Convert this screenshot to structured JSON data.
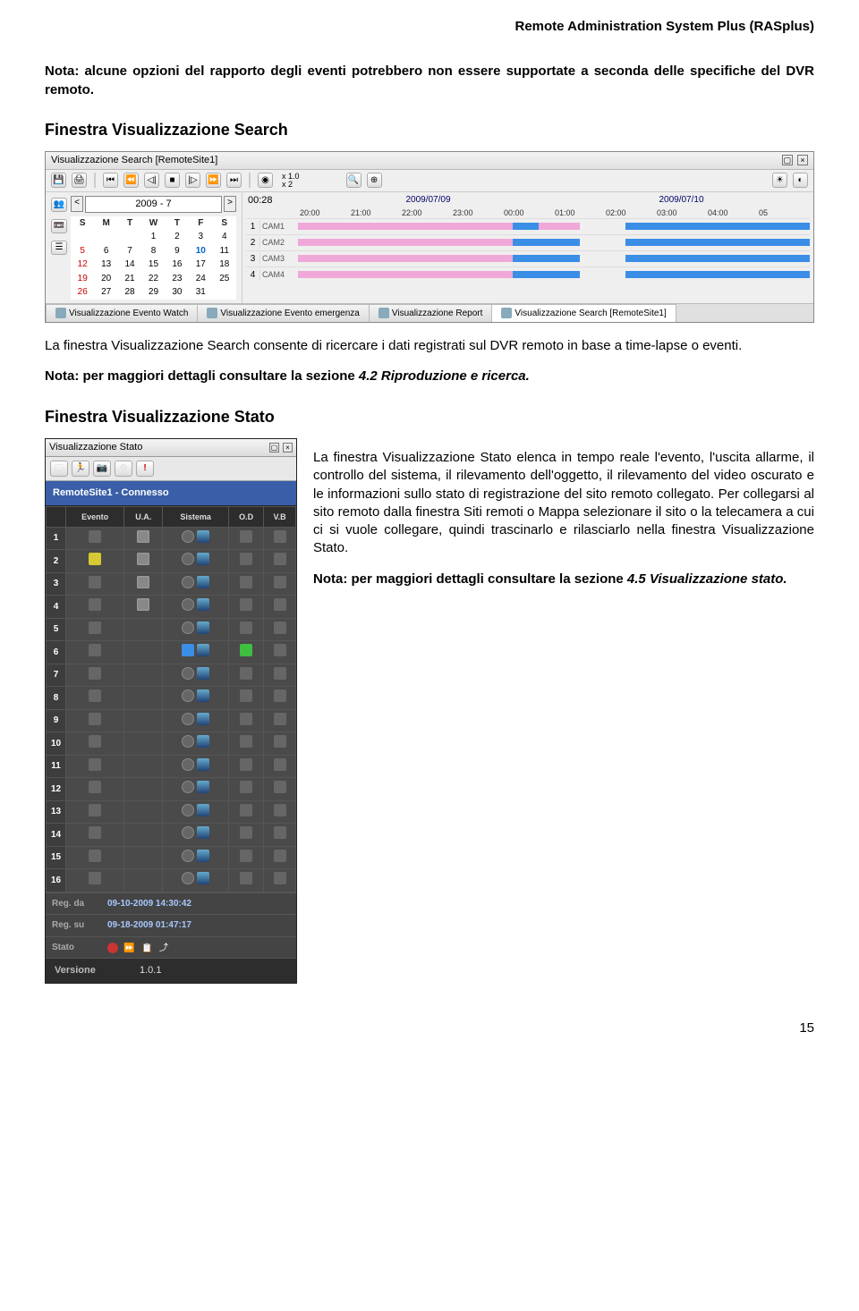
{
  "doc_header": "Remote Administration System Plus (RASplus)",
  "note_support": "Nota: alcune opzioni del rapporto degli eventi potrebbero non essere supportate a seconda delle specifiche del DVR remoto.",
  "heading_search": "Finestra Visualizzazione Search",
  "search_panel": {
    "title": "Visualizzazione Search [RemoteSite1]",
    "speed1": "x 1.0",
    "speed2": "x 2",
    "date_field": "2009 - 7",
    "cal_dow": [
      "S",
      "M",
      "T",
      "W",
      "T",
      "F",
      "S"
    ],
    "cal_rows": [
      [
        "",
        "",
        "",
        "1",
        "2",
        "3",
        "4"
      ],
      [
        "5",
        "6",
        "7",
        "8",
        "9",
        "10",
        "11"
      ],
      [
        "12",
        "13",
        "14",
        "15",
        "16",
        "17",
        "18"
      ],
      [
        "19",
        "20",
        "21",
        "22",
        "23",
        "24",
        "25"
      ],
      [
        "26",
        "27",
        "28",
        "29",
        "30",
        "31",
        ""
      ]
    ],
    "red_time": "00:28",
    "date_left": "2009/07/09",
    "date_right": "2009/07/10",
    "hours": [
      "20:00",
      "21:00",
      "22:00",
      "23:00",
      "00:00",
      "01:00",
      "02:00",
      "03:00",
      "04:00",
      "05"
    ],
    "cams": [
      {
        "n": "1",
        "label": "CAM1"
      },
      {
        "n": "2",
        "label": "CAM2"
      },
      {
        "n": "3",
        "label": "CAM3"
      },
      {
        "n": "4",
        "label": "CAM4"
      }
    ],
    "tabs": {
      "t1": "Visualizzazione Evento Watch",
      "t2": "Visualizzazione Evento emergenza",
      "t3": "Visualizzazione Report",
      "t4": "Visualizzazione Search [RemoteSite1]"
    }
  },
  "search_desc_1": "La finestra ",
  "search_desc_term": "Visualizzazione Search",
  "search_desc_2": " consente di ricercare i dati registrati sul DVR remoto in base a time-lapse o eventi.",
  "note_ref_search": "Nota: per maggiori dettagli consultare la sezione ",
  "note_ref_search_em": "4.2 Riproduzione e ricerca.",
  "heading_stato": "Finestra Visualizzazione Stato",
  "stato_panel": {
    "title": "Visualizzazione Stato",
    "conn": "RemoteSite1 - Connesso",
    "cols": {
      "c1": "Evento",
      "c2": "U.A.",
      "c3": "Sistema",
      "c4": "O.D",
      "c5": "V.B"
    },
    "rows": [
      "1",
      "2",
      "3",
      "4",
      "5",
      "6",
      "7",
      "8",
      "9",
      "10",
      "11",
      "12",
      "13",
      "14",
      "15",
      "16"
    ],
    "reg_da_label": "Reg. da",
    "reg_da_val": "09-10-2009 14:30:42",
    "reg_su_label": "Reg. su",
    "reg_su_val": "09-18-2009 01:47:17",
    "stato_label": "Stato",
    "versione_label": "Versione",
    "versione_val": "1.0.1"
  },
  "stato_desc": "La finestra Visualizzazione Stato elenca in tempo reale l'evento, l'uscita allarme, il controllo del sistema, il rilevamento dell'oggetto, il rilevamento del video oscurato e le informazioni sullo stato di registrazione del sito remoto collegato. Per collegarsi al sito remoto dalla finestra Siti remoti o Mappa selezionare il sito o la telecamera a cui ci si vuole collegare, quindi trascinarlo e rilasciarlo nella finestra Visualizzazione Stato.",
  "note_ref_stato": "Nota: per maggiori dettagli consultare la sezione ",
  "note_ref_stato_em": "4.5 Visualizzazione stato.",
  "page_number": "15"
}
